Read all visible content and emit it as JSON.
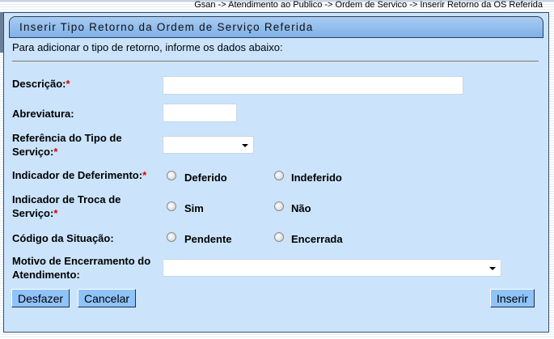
{
  "breadcrumb": "Gsan -> Atendimento ao Publico -> Ordem de Servico -> Inserir Retorno da OS Referida",
  "title": "Inserir Tipo Retorno da Ordem de Serviço Referida",
  "intro": "Para adicionar o tipo de retorno, informe os dados abaixo:",
  "required_mark": "*",
  "fields": {
    "descricao": {
      "label": "Descrição:",
      "value": ""
    },
    "abreviatura": {
      "label": "Abreviatura:",
      "value": ""
    },
    "referencia": {
      "label1": "Referência do Tipo de",
      "label2": "Serviço:",
      "value": ""
    },
    "deferimento": {
      "label": "Indicador de Deferimento:",
      "opt1": "Deferido",
      "opt2": "Indeferido"
    },
    "troca": {
      "label1": "Indicador de Troca de",
      "label2": "Serviço:",
      "opt1": "Sim",
      "opt2": "Não"
    },
    "situacao": {
      "label": "Código da Situação:",
      "opt1": "Pendente",
      "opt2": "Encerrada"
    },
    "motivo": {
      "label1": "Motivo de Encerramento do",
      "label2": "Atendimento:",
      "value": ""
    }
  },
  "buttons": {
    "desfazer": "Desfazer",
    "cancelar": "Cancelar",
    "inserir": "Inserir"
  }
}
